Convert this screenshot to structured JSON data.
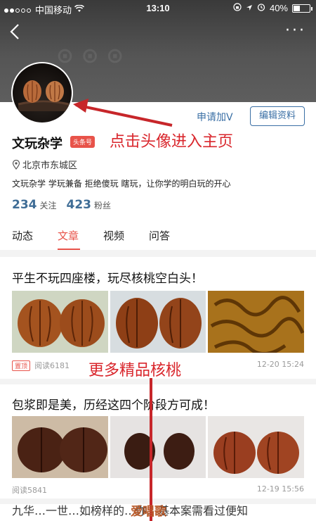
{
  "status_bar": {
    "carrier": "中国移动",
    "time": "13:10",
    "battery": "40%",
    "battery_level": 0.4
  },
  "profile": {
    "name": "文玩杂学",
    "badge": "头条号",
    "apply_v": "申请加V",
    "edit": "编辑资料",
    "location": "北京市东城区",
    "bio": "文玩杂学 学玩兼备 拒绝傻玩 瞎玩，让你学的明白玩的开心",
    "following_count": "234",
    "following_label": "关注",
    "fans_count": "423",
    "fans_label": "粉丝"
  },
  "annotations": {
    "avatar_hint": "点击头像进入主页",
    "more_hint": "更多精品核桃"
  },
  "tabs": [
    "动态",
    "文章",
    "视频",
    "问答"
  ],
  "active_tab": "文章",
  "articles": [
    {
      "title": "平生不玩四座楼，玩尽核桃空白头！",
      "pinned": "置顶",
      "reads": "阅读6181",
      "date": "12-20 15:24"
    },
    {
      "title": "包浆即是美，历经这四个阶段方可成！",
      "reads": "阅读5841",
      "date": "12-19 15:56"
    }
  ],
  "bottom_partial_text": "九华…一世…如榜样的…你…基本案需看过便知",
  "bottom_watermark": "爱唱歌",
  "colors": {
    "accent": "#e8534a",
    "link_blue": "#3a6fa5",
    "annotation_red": "#d9262c"
  }
}
